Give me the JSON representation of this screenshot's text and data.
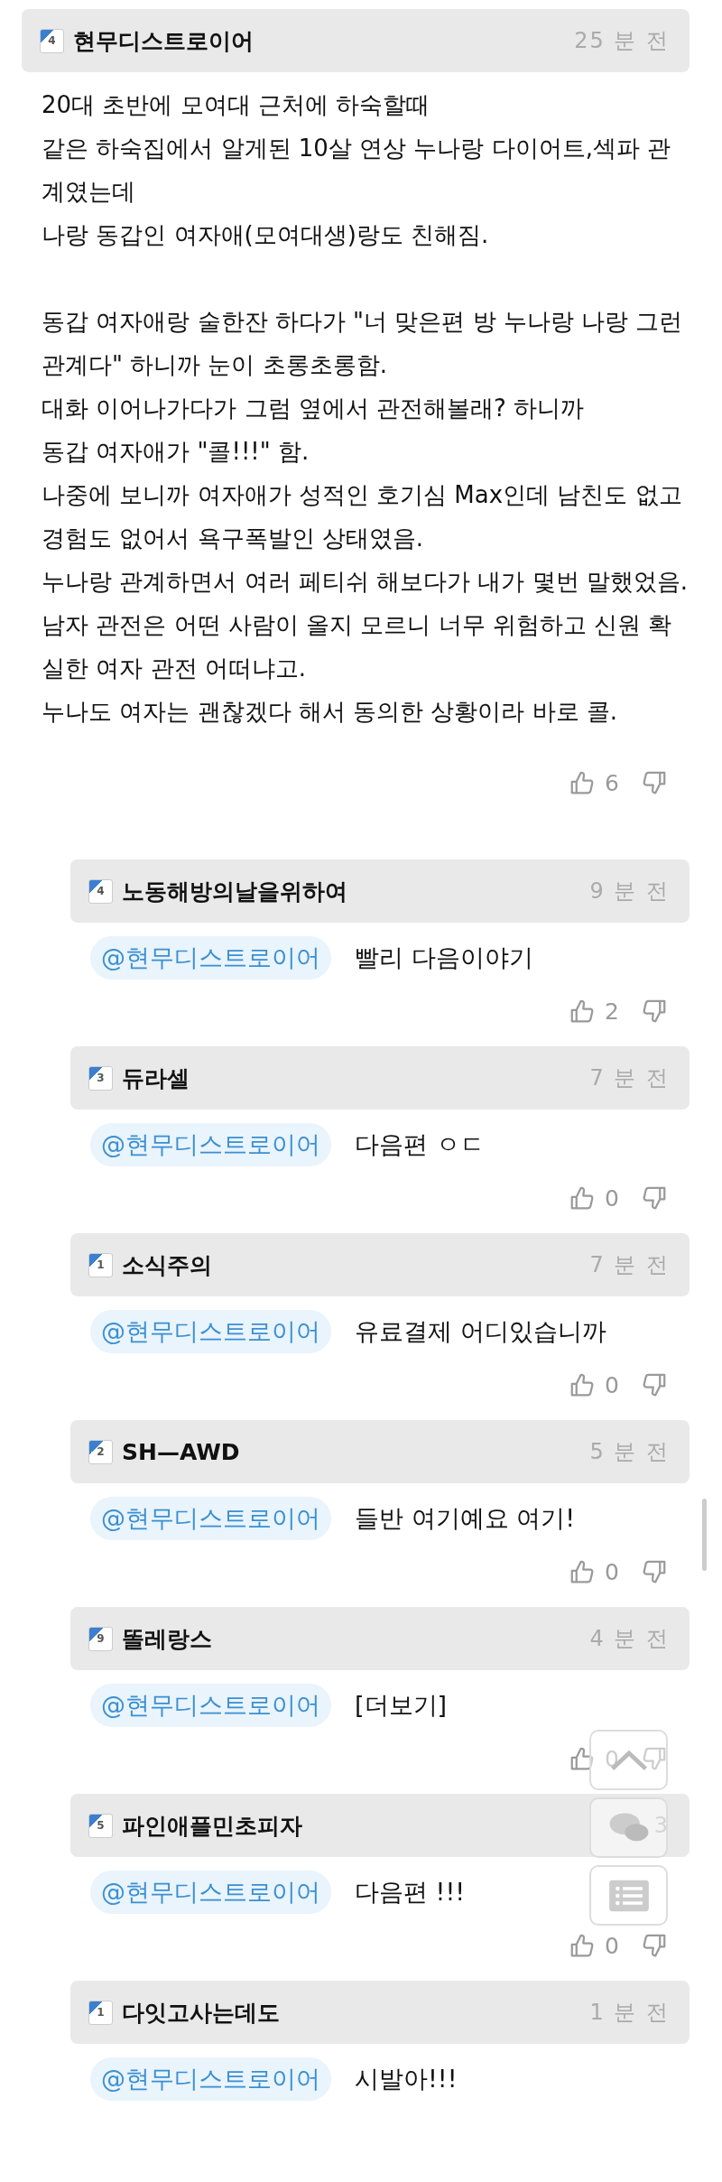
{
  "comment": {
    "rank": "4",
    "author": "현무디스트로이어",
    "time": "25 분 전",
    "paragraphs": [
      [
        "20대 초반에 모여대 근처에 하숙할때",
        "같은 하숙집에서 알게된 10살 연상 누나랑 다이어트,섹파 관계였는데",
        "나랑 동갑인 여자애(모여대생)랑도 친해짐."
      ],
      [
        "동갑 여자애랑 술한잔 하다가 \"너 맞은편 방 누나랑 나랑 그런 관계다\" 하니까 눈이 초롱초롱함.",
        "대화 이어나가다가 그럼 옆에서 관전해볼래? 하니까",
        "동갑 여자애가 \"콜!!!\" 함.",
        "나중에 보니까 여자애가 성적인 호기심 Max인데 남친도 없고 경험도 없어서 욕구폭발인 상태였음.",
        "누나랑 관계하면서 여러 페티쉬 해보다가 내가 몇번 말했었음. 남자 관전은 어떤 사람이 올지 모르니 너무 위험하고 신원 확실한 여자 관전 어떠냐고.",
        "누나도 여자는 괜찮겠다 해서 동의한 상황이라 바로 콜."
      ]
    ],
    "votes": true,
    "likes": "6"
  },
  "replies": [
    {
      "rank": "4",
      "author": "노동해방의날을위하여",
      "time": "9 분 전",
      "mention": "@현무디스트로이어",
      "text": "빨리 다음이야기",
      "votes": true,
      "likes": "2"
    },
    {
      "rank": "3",
      "author": "듀라셀",
      "time": "7 분 전",
      "mention": "@현무디스트로이어",
      "text": "다음편 ㅇㄷ",
      "votes": true,
      "likes": "0"
    },
    {
      "rank": "1",
      "author": "소식주의",
      "time": "7 분 전",
      "mention": "@현무디스트로이어",
      "text": "유료결제 어디있습니까",
      "votes": true,
      "likes": "0"
    },
    {
      "rank": "2",
      "author": "SH—AWD",
      "time": "5 분 전",
      "mention": "@현무디스트로이어",
      "text": "들반 여기예요 여기!",
      "votes": true,
      "likes": "0"
    },
    {
      "rank": "9",
      "author": "똘레랑스",
      "time": "4 분 전",
      "mention": "@현무디스트로이어",
      "text": "[더보기]",
      "votes": true,
      "likes": "0"
    },
    {
      "rank": "5",
      "author": "파인애플민초피자",
      "time": "3",
      "mention": "@현무디스트로이어",
      "text": "다음편 !!!",
      "votes": true,
      "likes": "0"
    },
    {
      "rank": "1",
      "author": "다잇고사는데도",
      "time": "1 분 전",
      "mention": "@현무디스트로이어",
      "text": "시발아!!!",
      "votes": false
    }
  ]
}
